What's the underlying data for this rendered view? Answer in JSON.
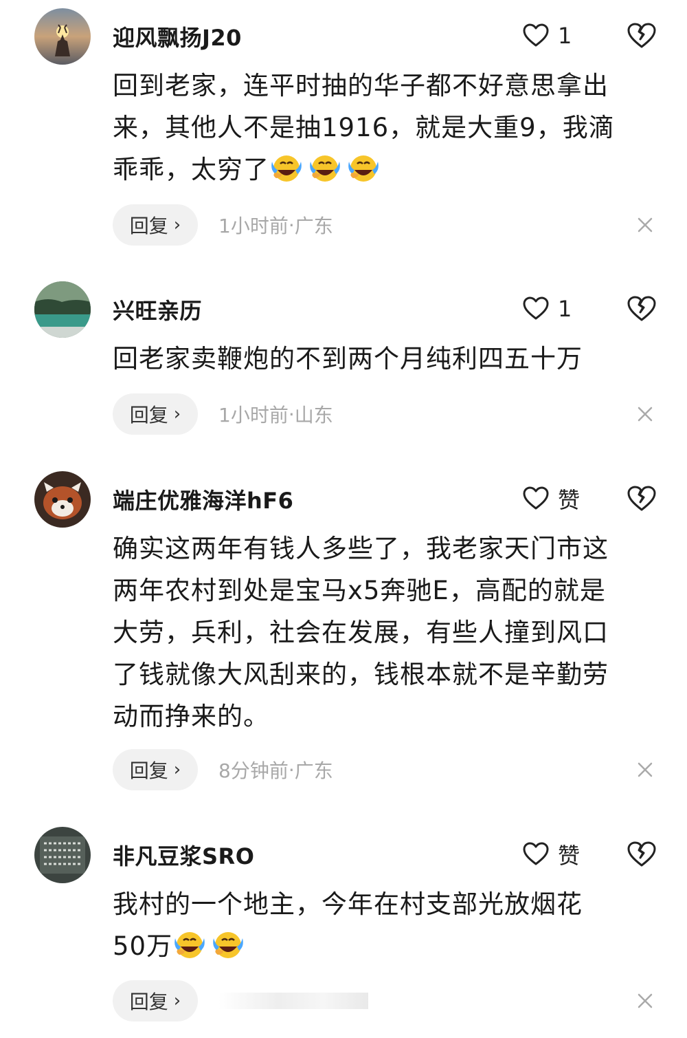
{
  "comments": [
    {
      "username": "迎风飘扬J20",
      "like_count": "1",
      "lines": [
        "回到老家，连平时抽的华子都不好意思拿出",
        "来，其他人不是抽1916，就是大重9，我滴",
        "乖乖，太穷了"
      ],
      "emoji_count": 3,
      "reply_label": "回复",
      "time": "1小时前",
      "location": "广东",
      "avatar_icon": "deer-sunset-avatar"
    },
    {
      "username": "兴旺亲历",
      "like_count": "1",
      "lines": [
        "回老家卖鞭炮的不到两个月纯利四五十万"
      ],
      "emoji_count": 0,
      "reply_label": "回复",
      "time": "1小时前",
      "location": "山东",
      "avatar_icon": "lake-landscape-avatar"
    },
    {
      "username": "端庄优雅海洋hF6",
      "like_count": "赞",
      "lines": [
        "确实这两年有钱人多些了，我老家天门市这",
        "两年农村到处是宝马x5奔驰E，高配的就是",
        "大劳，兵利，社会在发展，有些人撞到风口",
        "了钱就像大风刮来的，钱根本就不是辛勤劳",
        "动而挣来的。"
      ],
      "emoji_count": 0,
      "reply_label": "回复",
      "time": "8分钟前",
      "location": "广东",
      "avatar_icon": "red-panda-avatar"
    },
    {
      "username": "非凡豆浆SRO",
      "like_count": "赞",
      "lines": [
        "我村的一个地主，今年在村支部光放烟花",
        "50万"
      ],
      "emoji_count": 2,
      "reply_label": "回复",
      "time": "",
      "location": "",
      "avatar_icon": "schedule-board-avatar"
    }
  ],
  "meta_separator": " · ",
  "icons": {
    "like": "heart-outline-icon",
    "dislike": "broken-heart-icon",
    "close": "close-icon",
    "reply_chevron": "chevron-right-icon",
    "emoji": "laugh-cry-emoji"
  }
}
